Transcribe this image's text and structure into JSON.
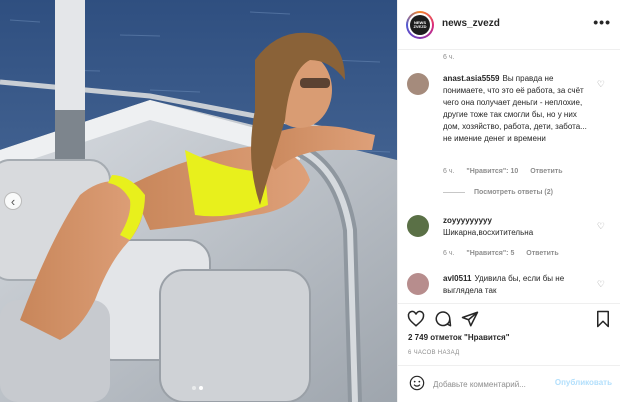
{
  "post": {
    "username": "news_zvezd",
    "avatar_text": "NEWS ZVEZD",
    "more_icon": "more-horizontal-icon",
    "first_comment_time": "6 ч."
  },
  "comments": [
    {
      "username": "anast.asia5559",
      "text": "Вы правда не понимаете, что это её работа, за счёт чего она получает деньги - неплохие, другие тоже так смогли бы, но у них дом, хозяйство, работа, дети, забота... не имение денег и времени",
      "time": "6 ч.",
      "likes": "\"Нравится\": 10",
      "reply": "Ответить",
      "view_replies": "Посмотреть ответы (2)",
      "avatar_color": "#a58b7c"
    },
    {
      "username": "zoyyyyyyyyy",
      "text": "Шикарна,восхитительна",
      "time": "6 ч.",
      "likes": "\"Нравится\": 5",
      "reply": "Ответить",
      "avatar_color": "#5a7046"
    },
    {
      "username": "avl0511",
      "text": "Удивила бы, если бы не выглядела так",
      "avatar_color": "#b78d8d"
    }
  ],
  "actions": {
    "likes_text": "2 749 отметок \"Нравится\"",
    "time_ago": "6 ЧАСОВ НАЗАД",
    "comment_placeholder": "Добавьте комментарий...",
    "publish_label": "Опубликовать"
  },
  "carousel": {
    "nav_prev": "‹",
    "current_slide": 2,
    "total_slides": 2
  },
  "colors": {
    "bikini": "#e8f01c",
    "sea": "#3f5f8d",
    "publish_disabled": "#b2dffc"
  }
}
